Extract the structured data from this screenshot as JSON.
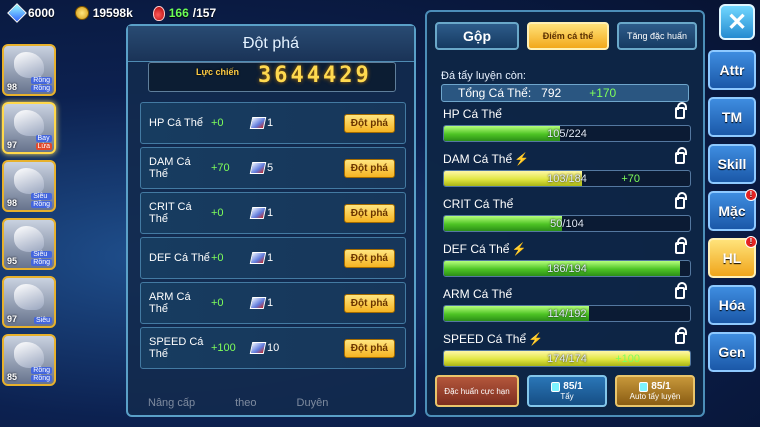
{
  "topbar": {
    "gems": "6000",
    "gold": "19598k",
    "stamina_current": "166",
    "stamina_max": "/157"
  },
  "roster": [
    {
      "level": "98",
      "tags": [
        "Rồng",
        "Rồng"
      ]
    },
    {
      "level": "97",
      "tags": [
        "Bay",
        "Lửa"
      ]
    },
    {
      "level": "98",
      "tags": [
        "Siêu",
        "Rồng"
      ]
    },
    {
      "level": "95",
      "tags": [
        "Siêu",
        "Rồng"
      ]
    },
    {
      "level": "97",
      "tags": [
        "Siêu"
      ]
    },
    {
      "level": "85",
      "tags": [
        "Rồng",
        "Rồng"
      ]
    }
  ],
  "breakthrough": {
    "title": "Đột phá",
    "power_label": "Lực chiến",
    "power_value": "3644429",
    "button_label": "Đột phá",
    "rows": [
      {
        "name": "HP Cá Thể",
        "bonus": "+0",
        "count": "1"
      },
      {
        "name": "DAM Cá Thể",
        "bonus": "+70",
        "count": "5"
      },
      {
        "name": "CRIT Cá Thể",
        "bonus": "+0",
        "count": "1"
      },
      {
        "name": "DEF Cá Thể",
        "bonus": "+0",
        "count": "1"
      },
      {
        "name": "ARM Cá Thể",
        "bonus": "+0",
        "count": "1"
      },
      {
        "name": "SPEED Cá Thể",
        "bonus": "+100",
        "count": "10"
      }
    ],
    "bottom_tabs": [
      "Nâng cấp",
      "theo",
      "Duyên"
    ]
  },
  "stats_panel": {
    "tabs": [
      "Gộp",
      "Điểm cá thể",
      "Tăng đặc huấn"
    ],
    "remain_label": "Đá tẩy luyện còn:",
    "total_label": "Tổng Cá Thể:",
    "total_value": "792",
    "total_bonus": "+170",
    "stats": [
      {
        "name": "HP Cá Thể",
        "value": "105/224",
        "fill": 0.47,
        "bonus": "",
        "bolt": false,
        "color": "green"
      },
      {
        "name": "DAM Cá Thể",
        "value": "103/184",
        "fill": 0.56,
        "bonus": "+70",
        "bolt": true,
        "color": "yellow"
      },
      {
        "name": "CRIT Cá Thể",
        "value": "50/104",
        "fill": 0.48,
        "bonus": "",
        "bolt": false,
        "color": "green"
      },
      {
        "name": "DEF Cá Thể",
        "value": "186/194",
        "fill": 0.96,
        "bonus": "",
        "bolt": true,
        "color": "green"
      },
      {
        "name": "ARM Cá Thể",
        "value": "114/192",
        "fill": 0.59,
        "bonus": "",
        "bolt": false,
        "color": "green"
      },
      {
        "name": "SPEED Cá Thể",
        "value": "174/174",
        "fill": 1.0,
        "bonus": "+100",
        "bolt": true,
        "color": "yellow"
      }
    ],
    "actions": {
      "special_label": "Đặc huấn cực hạn",
      "wash_count": "85/1",
      "wash_label": "Tẩy",
      "auto_count": "85/1",
      "auto_label": "Auto tẩy luyện"
    }
  },
  "side_menu": [
    "Attr",
    "TM",
    "Skill",
    "Mặc",
    "HL",
    "Hóa",
    "Gen"
  ]
}
